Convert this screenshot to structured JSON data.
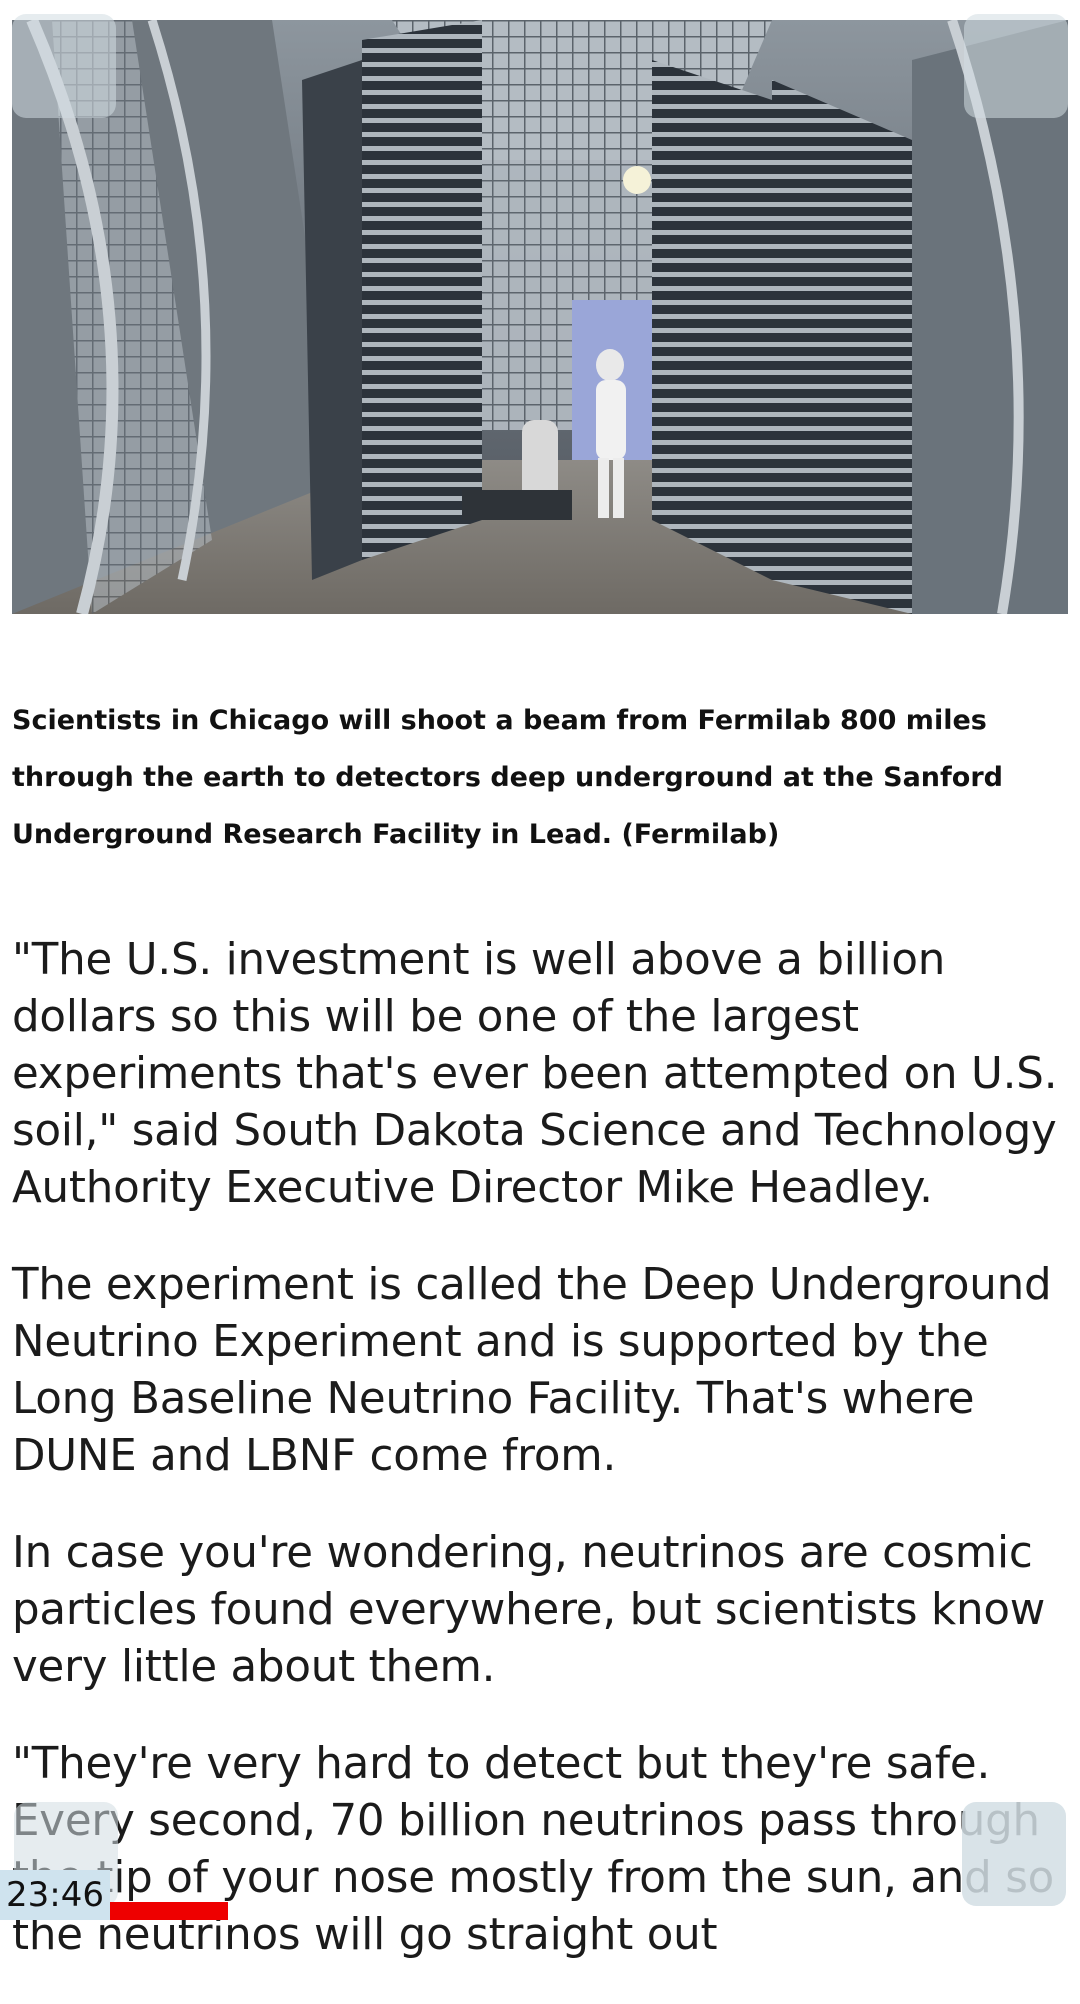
{
  "article": {
    "image": {
      "icon": "photo-fermilab-detector"
    },
    "caption": "Scientists in Chicago will shoot a beam from Fermilab 800 miles through the earth to detectors deep underground at the Sanford Underground Research Facility in Lead. (Fermilab)",
    "paragraphs": [
      "\"The U.S. investment is well above a billion dollars so this will be one of the largest experiments that's ever been attempted on U.S. soil,\" said South Dakota Science and Technology Authority Executive Director Mike Headley.",
      "The experiment is called the Deep Underground Neutrino Experiment and is supported by the Long Baseline Neutrino Facility. That's where DUNE and LBNF come from.",
      "In case you're wondering, neutrinos are cosmic particles found everywhere, but scientists know very little about them.",
      "\"They're very hard to detect but they're safe. Every second, 70 billion neutrinos pass through the tip of your nose mostly from the sun, and so the neutrinos will go straight out"
    ]
  },
  "status": {
    "clock": "23:46",
    "accent": "#ee0000"
  },
  "colors": {
    "overlay_button": "#d2dce2",
    "clock_bg": "#cfe3ee"
  }
}
